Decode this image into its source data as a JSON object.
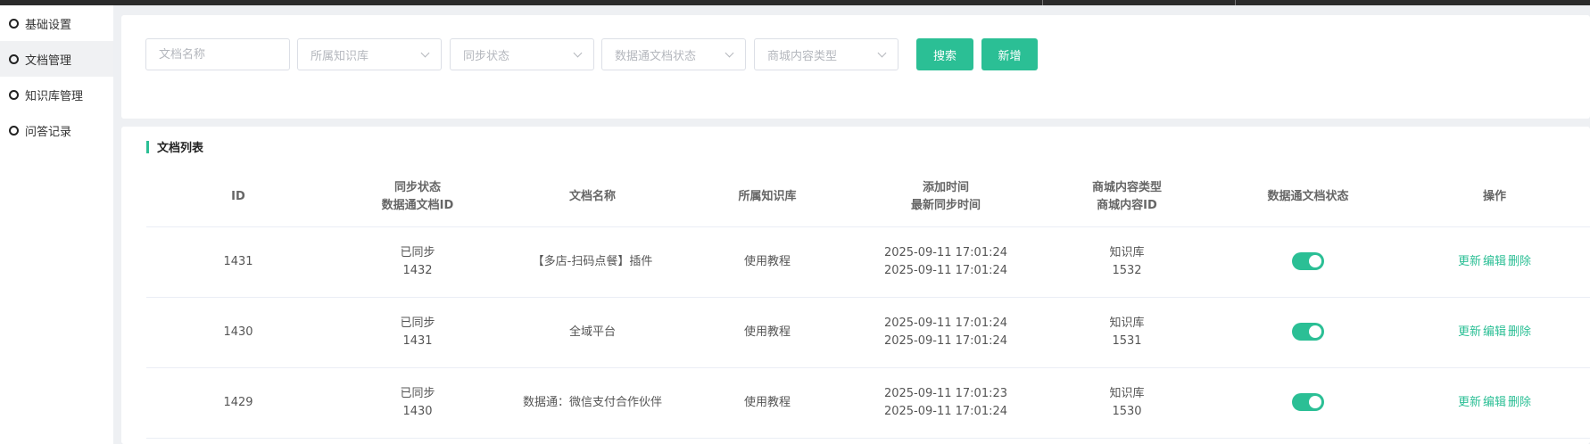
{
  "sidebar": {
    "items": [
      {
        "label": "基础设置",
        "active": false
      },
      {
        "label": "文档管理",
        "active": true
      },
      {
        "label": "知识库管理",
        "active": false
      },
      {
        "label": "问答记录",
        "active": false
      }
    ]
  },
  "search": {
    "doc_name_placeholder": "文档名称",
    "kb_placeholder": "所属知识库",
    "sync_status_placeholder": "同步状态",
    "sjt_status_placeholder": "数据通文档状态",
    "mall_type_placeholder": "商城内容类型",
    "search_label": "搜索",
    "add_label": "新增"
  },
  "list": {
    "title": "文档列表",
    "columns": {
      "id": "ID",
      "sync_status": "同步状态",
      "sjt_doc_id": "数据通文档ID",
      "doc_name": "文档名称",
      "kb": "所属知识库",
      "added_time": "添加时间",
      "latest_sync_time": "最新同步时间",
      "mall_type": "商城内容类型",
      "mall_content_id": "商城内容ID",
      "sjt_status": "数据通文档状态",
      "actions": "操作"
    },
    "action_labels": {
      "update": "更新",
      "edit": "编辑",
      "delete": "删除"
    },
    "rows": [
      {
        "id": "1431",
        "sync_status": "已同步",
        "sjt_doc_id": "1432",
        "doc_name": "【多店-扫码点餐】插件",
        "kb": "使用教程",
        "added_time": "2025-09-11 17:01:24",
        "sync_time": "2025-09-11 17:01:24",
        "mall_type": "知识库",
        "mall_id": "1532",
        "enabled": true
      },
      {
        "id": "1430",
        "sync_status": "已同步",
        "sjt_doc_id": "1431",
        "doc_name": "全域平台",
        "kb": "使用教程",
        "added_time": "2025-09-11 17:01:24",
        "sync_time": "2025-09-11 17:01:24",
        "mall_type": "知识库",
        "mall_id": "1531",
        "enabled": true
      },
      {
        "id": "1429",
        "sync_status": "已同步",
        "sjt_doc_id": "1430",
        "doc_name": "数据通：微信支付合作伙伴",
        "kb": "使用教程",
        "added_time": "2025-09-11 17:01:23",
        "sync_time": "2025-09-11 17:01:24",
        "mall_type": "知识库",
        "mall_id": "1530",
        "enabled": true
      }
    ]
  },
  "colors": {
    "accent": "#2bbf95"
  }
}
